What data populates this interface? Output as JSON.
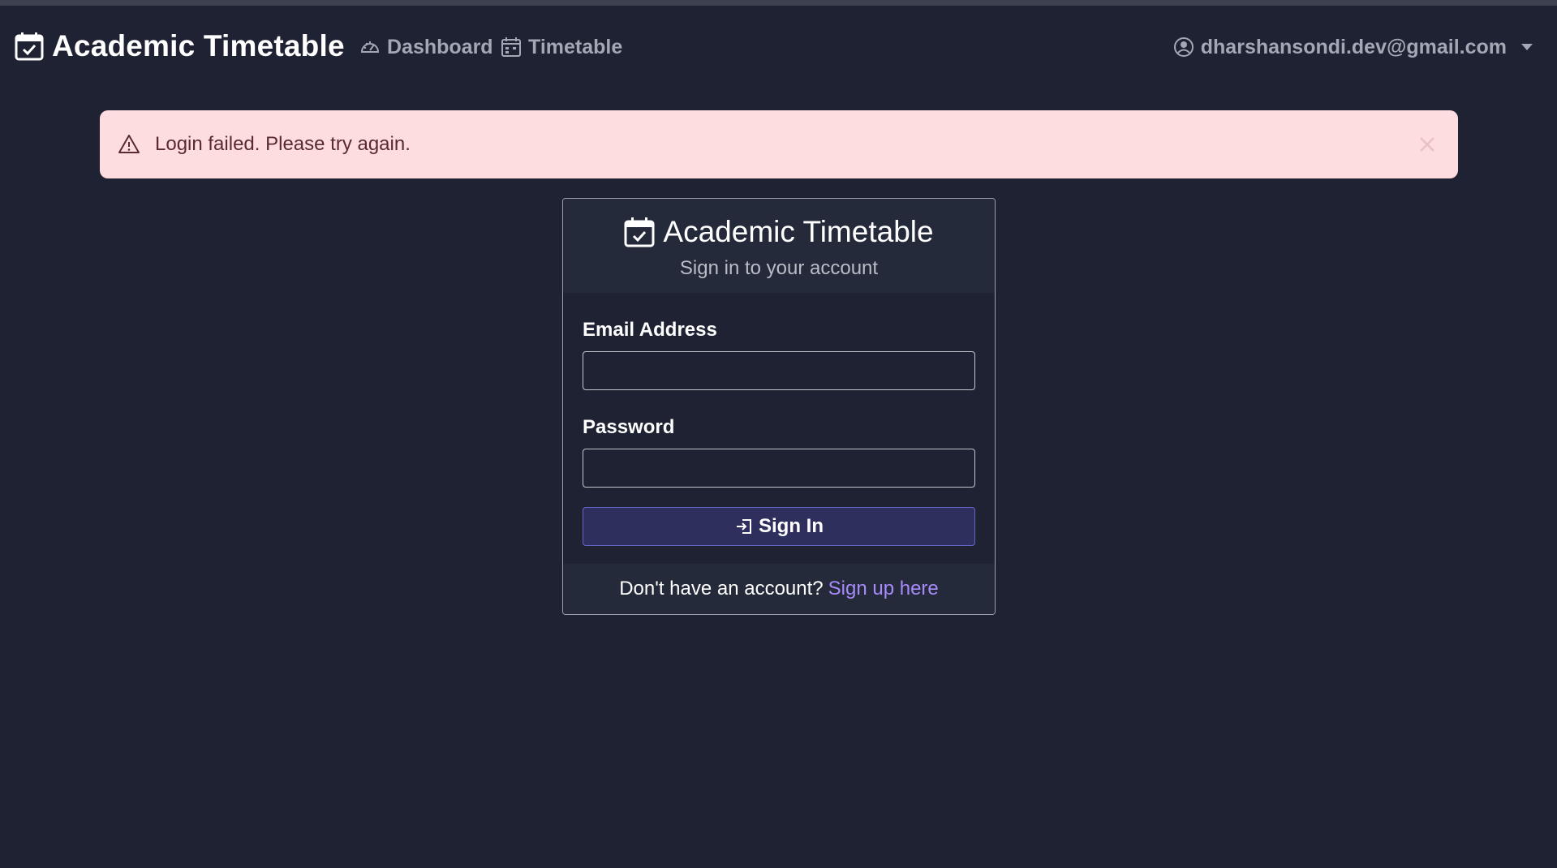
{
  "app": {
    "brand_name": "Academic Timetable"
  },
  "nav": {
    "links": [
      {
        "label": "Dashboard",
        "icon": "speedometer-icon"
      },
      {
        "label": "Timetable",
        "icon": "calendar-week-icon"
      }
    ],
    "user_email": "dharshansondi.dev@gmail.com"
  },
  "alert": {
    "message": "Login failed. Please try again.",
    "type": "danger"
  },
  "login_card": {
    "title": "Academic Timetable",
    "subtitle": "Sign in to your account",
    "email_label": "Email Address",
    "email_value": "",
    "password_label": "Password",
    "password_value": "",
    "submit_label": "Sign In",
    "footer_prompt": "Don't have an account?",
    "signup_link_label": "Sign up here"
  },
  "colors": {
    "background": "#1e2233",
    "card_header": "#252a3a",
    "alert_background": "#fedde0",
    "button_background": "#2f2f5e",
    "link": "#a78bfa"
  }
}
